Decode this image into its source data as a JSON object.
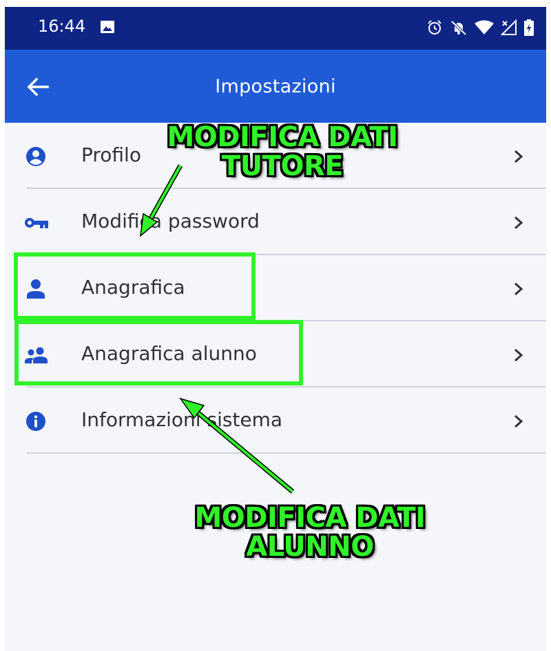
{
  "status_bar": {
    "time": "16:44",
    "icons": [
      "image-icon",
      "alarm-icon",
      "dnd-icon",
      "wifi-icon",
      "no-signal-icon",
      "battery-icon"
    ]
  },
  "app_bar": {
    "title": "Impostazioni",
    "back_icon": "arrow-left-icon"
  },
  "menu": {
    "items": [
      {
        "label": "Profilo",
        "icon": "account-circle-icon"
      },
      {
        "label": "Modifica password",
        "icon": "key-icon"
      },
      {
        "label": "Anagrafica",
        "icon": "person-icon"
      },
      {
        "label": "Anagrafica alunno",
        "icon": "people-icon"
      },
      {
        "label": "Informazioni sistema",
        "icon": "info-icon"
      }
    ]
  },
  "annotations": {
    "tutore_line1": "MODIFICA DATI",
    "tutore_line2": "TUTORE",
    "alunno_line1": "MODIFICA DATI",
    "alunno_line2": "ALUNNO"
  },
  "colors": {
    "status_bar": "#0e2586",
    "app_bar": "#1f5bd6",
    "icon_blue": "#1f4fc9",
    "annotation_green": "#31f22a"
  }
}
